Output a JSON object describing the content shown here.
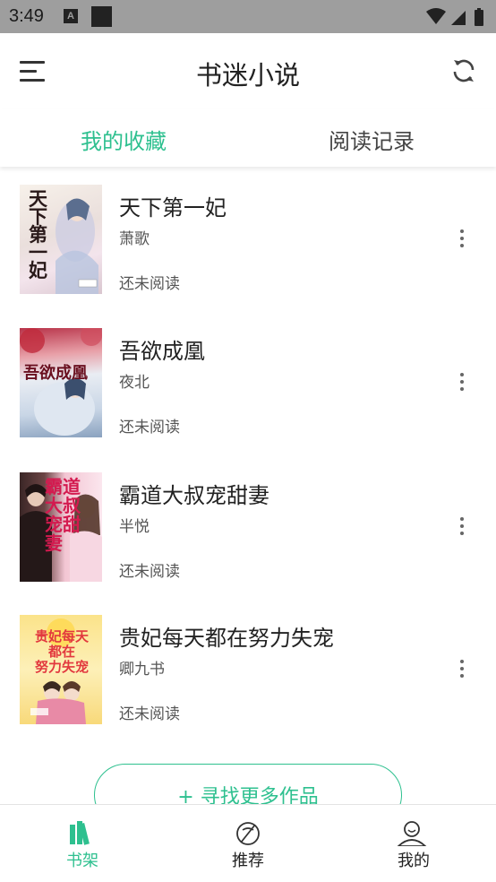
{
  "status_bar": {
    "time": "3:49",
    "notification_icon": "A"
  },
  "app_bar": {
    "title": "书迷小说",
    "menu_icon": "hamburger-icon",
    "refresh_icon": "refresh-icon"
  },
  "tabs": [
    {
      "label": "我的收藏",
      "active": true
    },
    {
      "label": "阅读记录",
      "active": false
    }
  ],
  "books": [
    {
      "title": "天下第一妃",
      "author": "萧歌",
      "status": "还未阅读",
      "cover_text": "天下第一妃"
    },
    {
      "title": "吾欲成凰",
      "author": "夜北",
      "status": "还未阅读",
      "cover_text": "吾欲成凰"
    },
    {
      "title": "霸道大叔宠甜妻",
      "author": "半悦",
      "status": "还未阅读",
      "cover_text": "霸道大叔宠甜妻"
    },
    {
      "title": "贵妃每天都在努力失宠",
      "author": "卿九书",
      "status": "还未阅读",
      "cover_text": "贵妃每天都在努力失宠"
    }
  ],
  "find_more_label": "+ 寻找更多作品",
  "bottom_nav": [
    {
      "label": "书架",
      "icon": "bookshelf-icon",
      "active": true
    },
    {
      "label": "推荐",
      "icon": "compass-icon",
      "active": false
    },
    {
      "label": "我的",
      "icon": "profile-icon",
      "active": false
    }
  ],
  "colors": {
    "accent": "#2ec08f",
    "status_bar": "#9e9e9e"
  }
}
